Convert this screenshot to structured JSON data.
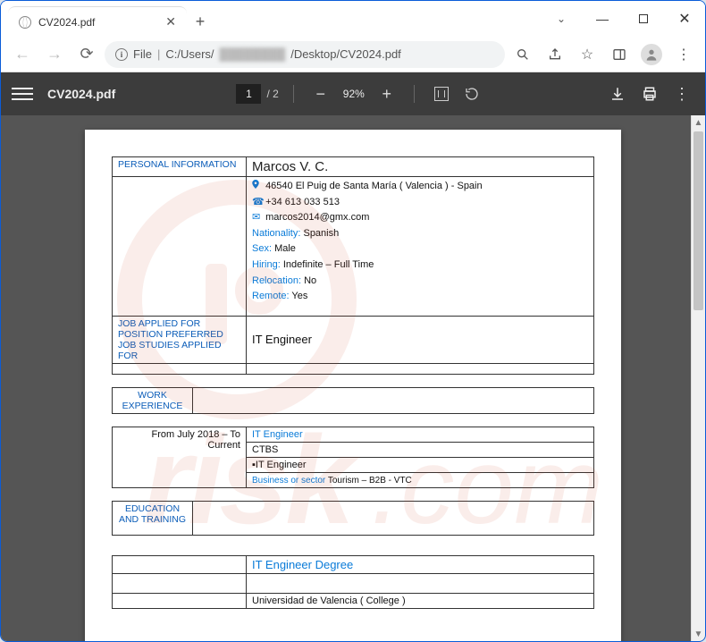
{
  "tab": {
    "title": "CV2024.pdf"
  },
  "url": {
    "prefix": "File",
    "path_pre": "C:/Users/",
    "path_blur": "████████",
    "path_post": "/Desktop/CV2024.pdf"
  },
  "pdf": {
    "file": "CV2024.pdf",
    "page": "1",
    "total": "/  2",
    "zoom": "92%"
  },
  "cv": {
    "sect_personal": "PERSONAL INFORMATION",
    "name": "Marcos V. C.",
    "addr": "46540 El Puig de Santa María ( Valencia ) - Spain",
    "phone": "+34 613 033 513",
    "email": "marcos2014@gmx.com",
    "nat_k": "Nationality:",
    "nat_v": " Spanish",
    "sex_k": "Sex:",
    "sex_v": " Male",
    "hiring_k": "Hiring:",
    "hiring_v": "  Indefinite  – Full Time",
    "reloc_k": "Relocation:",
    "reloc_v": "   No",
    "remote_k": "Remote:",
    "remote_v": " Yes",
    "sect_job": "JOB APPLIED FOR POSITION PREFERRED JOB STUDIES APPLIED FOR",
    "job_val": "IT Engineer",
    "sect_work": "WORK EXPERIENCE",
    "work_dates": "From July 2018 – To Current",
    "work_title": "IT  Engineer",
    "work_company": "CTBS",
    "work_role": "▪IT Engineer",
    "work_sector_k": "Business or sector",
    "work_sector_v": " Tourism – B2B - VTC",
    "sect_edu": "EDUCATION AND TRAINING",
    "edu_title": "IT Engineer Degree",
    "edu_school": "Universidad de Valencia ( College )"
  }
}
